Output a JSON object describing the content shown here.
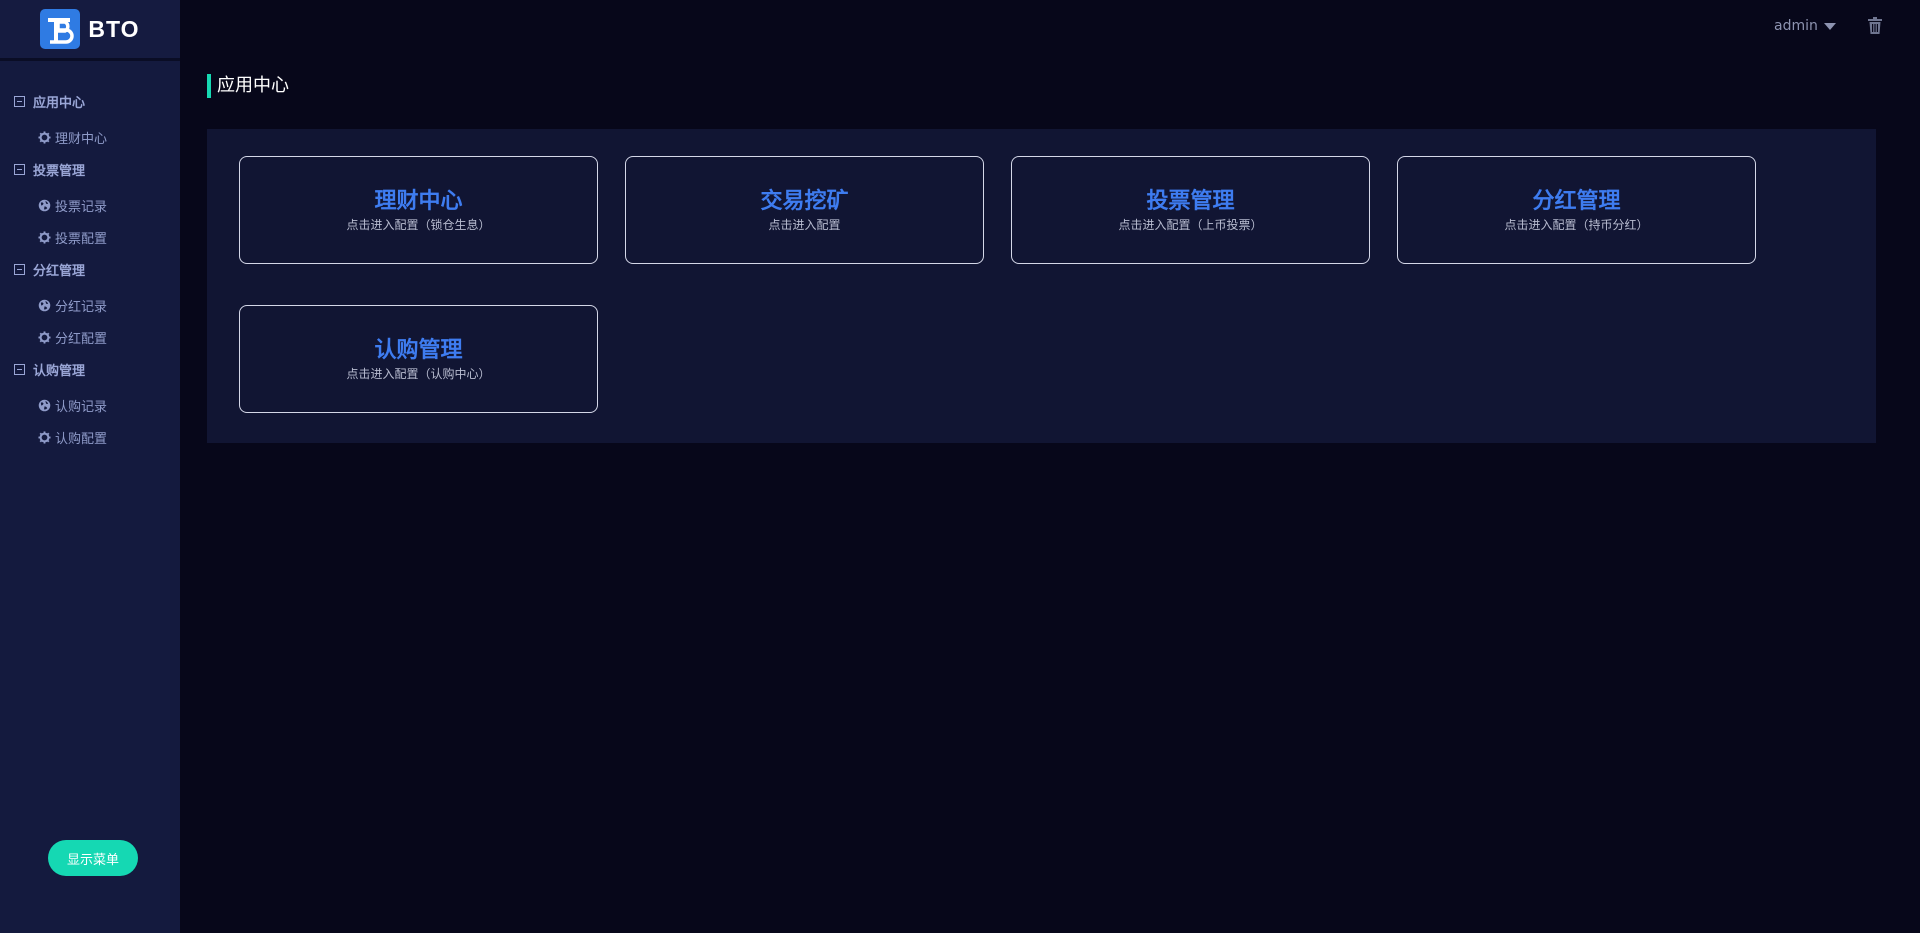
{
  "app": {
    "logo_text": "BTO"
  },
  "header": {
    "username": "admin"
  },
  "sidebar": {
    "groups": [
      {
        "label": "应用中心",
        "items": [
          {
            "label": "理财中心",
            "icon": "gear-icon"
          }
        ]
      },
      {
        "label": "投票管理",
        "items": [
          {
            "label": "投票记录",
            "icon": "globe-icon"
          },
          {
            "label": "投票配置",
            "icon": "gear-icon"
          }
        ]
      },
      {
        "label": "分红管理",
        "items": [
          {
            "label": "分红记录",
            "icon": "globe-icon"
          },
          {
            "label": "分红配置",
            "icon": "gear-icon"
          }
        ]
      },
      {
        "label": "认购管理",
        "items": [
          {
            "label": "认购记录",
            "icon": "globe-icon"
          },
          {
            "label": "认购配置",
            "icon": "gear-icon"
          }
        ]
      }
    ],
    "show_menu_label": "显示菜单"
  },
  "main": {
    "title": "应用中心",
    "cards": [
      {
        "title": "理财中心",
        "desc": "点击进入配置（锁仓生息）"
      },
      {
        "title": "交易挖矿",
        "desc": "点击进入配置"
      },
      {
        "title": "投票管理",
        "desc": "点击进入配置（上币投票）"
      },
      {
        "title": "分红管理",
        "desc": "点击进入配置（持币分红）"
      },
      {
        "title": "认购管理",
        "desc": "点击进入配置（认购中心）"
      }
    ]
  },
  "colors": {
    "accent": "#16d8b2",
    "card_title": "#3e7cf0",
    "sidebar_bg": "#141a3e",
    "page_bg": "#07071a"
  }
}
